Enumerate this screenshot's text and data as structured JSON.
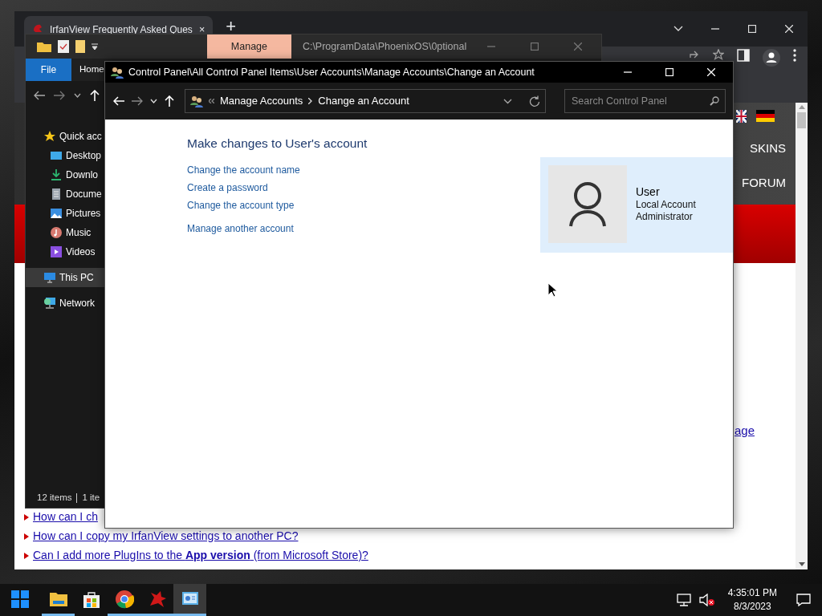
{
  "browser": {
    "tab": {
      "title": "IrfanView Frequently Asked Ques",
      "close": "×"
    },
    "new_tab": "+",
    "nav_links": [
      "SKINS",
      "FORUM"
    ],
    "cut_link": "age",
    "faq_links": [
      "How can I ch",
      "How can I copy my IrfanView settings to another PC?",
      "Can I add more PlugIns to the **App version** (from Microsoft Store)?"
    ]
  },
  "explorer": {
    "ribbon_tab": {
      "label": "Manage",
      "selected": true
    },
    "path": "C:\\ProgramData\\PhoenixOS\\0ptional",
    "menu": [
      "File",
      "Home"
    ],
    "sidebar": [
      {
        "kind": "star",
        "label": "Quick acc",
        "selected": false
      },
      {
        "kind": "desktop",
        "label": "Desktop",
        "selected": false
      },
      {
        "kind": "download",
        "label": "Downlo",
        "selected": false
      },
      {
        "kind": "document",
        "label": "Docume",
        "selected": false
      },
      {
        "kind": "pictures",
        "label": "Pictures",
        "selected": false
      },
      {
        "kind": "music",
        "label": "Music",
        "selected": false
      },
      {
        "kind": "videos",
        "label": "Videos",
        "selected": false
      },
      {
        "kind": "pc",
        "label": "This PC",
        "selected": true
      },
      {
        "kind": "network",
        "label": "Network",
        "selected": false
      }
    ],
    "status_bar": [
      "12 items",
      "1 ite"
    ]
  },
  "control_panel": {
    "title": "Control Panel\\All Control Panel Items\\User Accounts\\Manage Accounts\\Change an Account",
    "breadcrumb": [
      "Manage Accounts",
      "Change an Account"
    ],
    "search": {
      "placeholder": "Search Control Panel"
    },
    "heading": "Make changes to User's account",
    "tasks": [
      "Change the account name",
      "Create a password",
      "Change the account type"
    ],
    "other_task": "Manage another account",
    "account": {
      "name": "User",
      "details": [
        "Local Account",
        "Administrator"
      ]
    }
  },
  "taskbar": {
    "apps": [
      {
        "kind": "start",
        "running": false,
        "active": false
      },
      {
        "kind": "explorer",
        "running": true,
        "active": false
      },
      {
        "kind": "store",
        "running": false,
        "active": false
      },
      {
        "kind": "chrome",
        "running": true,
        "active": false
      },
      {
        "kind": "irfanview",
        "running": true,
        "active": false
      },
      {
        "kind": "controlpanel",
        "running": true,
        "active": true
      }
    ],
    "time": "4:35:01 PM",
    "date": "8/3/2023"
  }
}
